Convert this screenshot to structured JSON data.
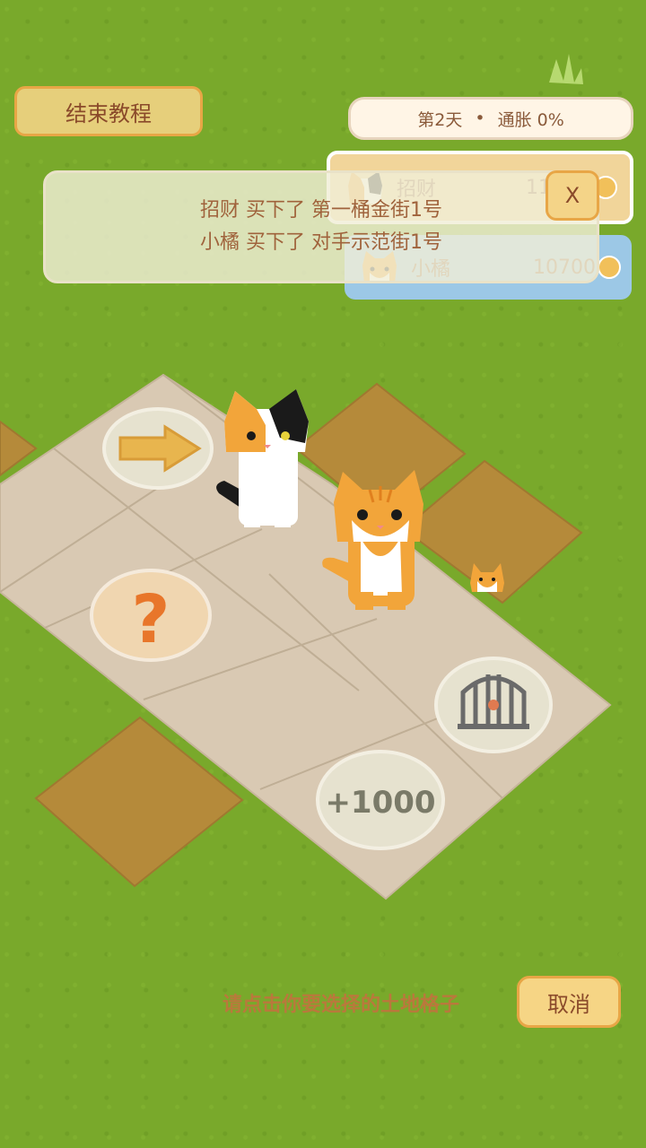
{
  "header": {
    "end_tutorial_label": "结束教程",
    "day": "第2天",
    "separator": "•",
    "inflation": "通胀 0%"
  },
  "players": [
    {
      "name": "招财",
      "money": "11100",
      "color": "#f1d59a",
      "icon": "calico-cat-avatar"
    },
    {
      "name": "小橘",
      "money": "10700",
      "color": "#9cc8e6",
      "icon": "orange-cat-avatar"
    }
  ],
  "toast": {
    "line1": "招财 买下了 第一桶金街1号",
    "line2": "小橘 买下了 对手示范街1号",
    "close_label": "X"
  },
  "board": {
    "tiles": [
      {
        "type": "arrow",
        "icon": "arrow-right-icon"
      },
      {
        "type": "question",
        "icon": "question-mark-icon"
      },
      {
        "type": "jail",
        "icon": "cage-icon"
      },
      {
        "type": "bonus",
        "label": "+1000"
      }
    ],
    "properties": [
      "brown-plot",
      "brown-plot",
      "brown-plot",
      "brown-plot"
    ]
  },
  "footer": {
    "hint": "请点击你要选择的土地格子",
    "cancel_label": "取消"
  },
  "colors": {
    "grass": "#79a92b",
    "tile": "#d8c8b2",
    "plot": "#b58a3a",
    "accent": "#e8a646"
  }
}
